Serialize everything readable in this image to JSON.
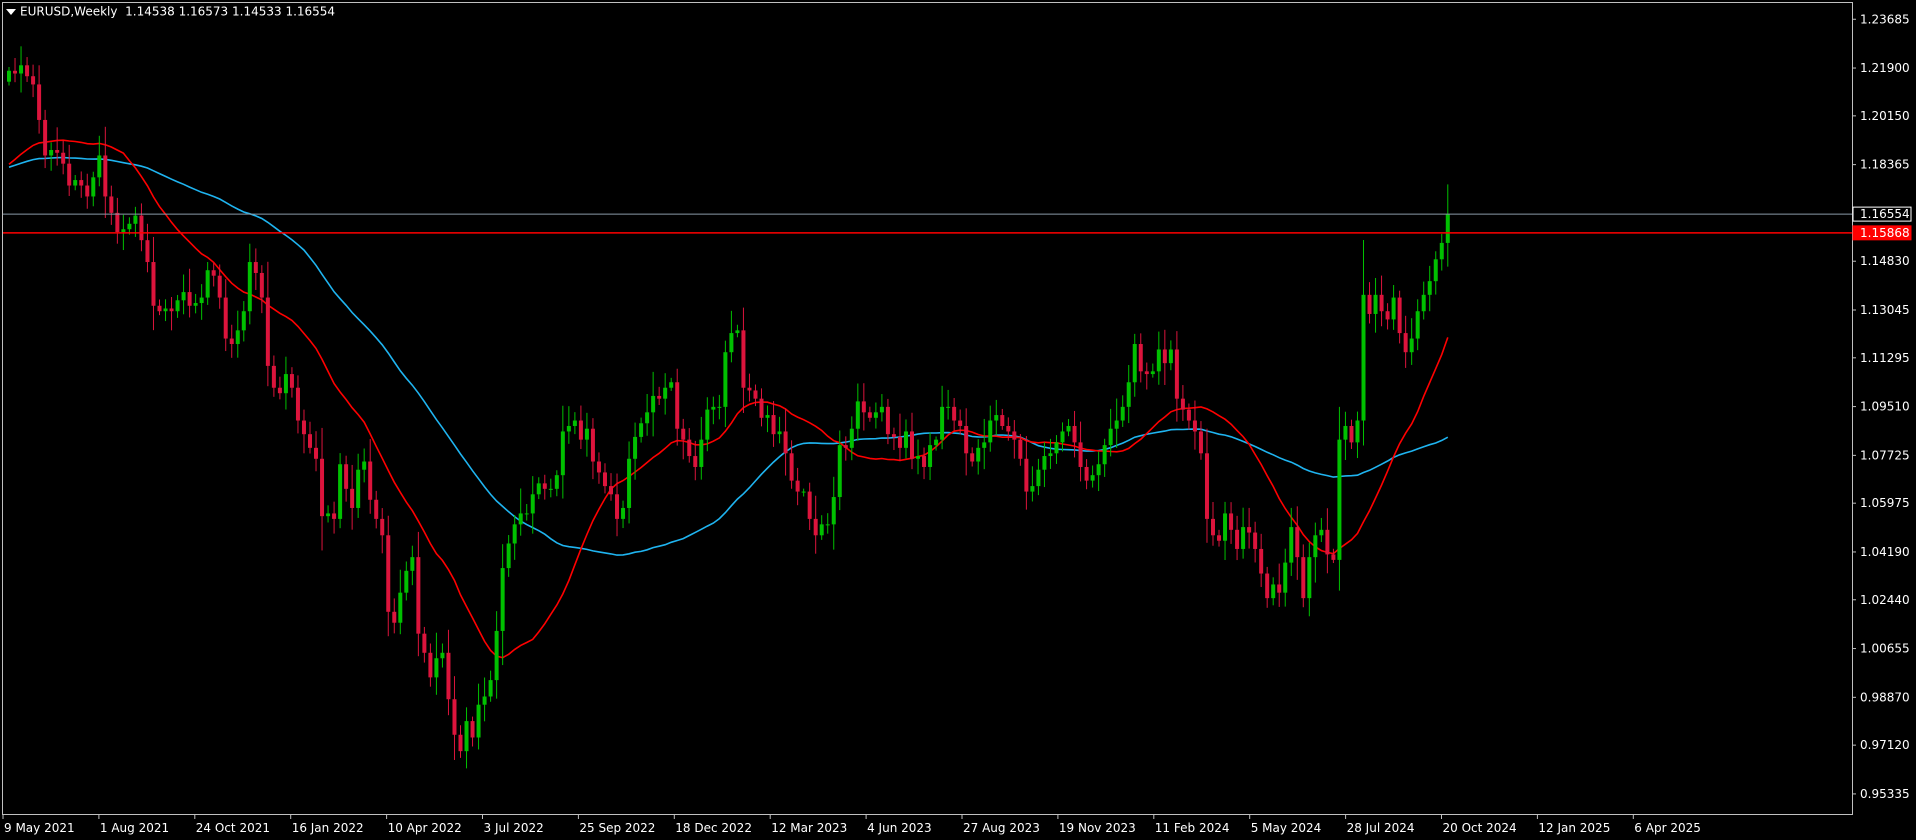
{
  "header": {
    "symbol": "EURUSD,Weekly",
    "ohlc": "1.14538 1.16573 1.14533 1.16554"
  },
  "colors": {
    "background": "#000000",
    "frame": "#c0c0c0",
    "bull": "#00c000",
    "bear": "#dc143c",
    "ma_fast": "#ff0000",
    "ma_slow": "#1fb4f0",
    "hline": "#ff0000",
    "bid_line": "#8a9aa8",
    "text": "#ffffff"
  },
  "chart_data": {
    "type": "candlestick",
    "symbol": "EURUSD",
    "timeframe": "Weekly",
    "ylim": [
      0.946,
      1.2428
    ],
    "y_ticks": [
      "1.23685",
      "1.21900",
      "1.20150",
      "1.18365",
      "1.16554",
      "1.14830",
      "1.13045",
      "1.11295",
      "1.09510",
      "1.07725",
      "1.05975",
      "1.04190",
      "1.02440",
      "1.00655",
      "0.98870",
      "0.97120",
      "0.95335"
    ],
    "x_ticks": [
      "9 May 2021",
      "1 Aug 2021",
      "24 Oct 2021",
      "16 Jan 2022",
      "10 Apr 2022",
      "3 Jul 2022",
      "25 Sep 2022",
      "18 Dec 2022",
      "12 Mar 2023",
      "4 Jun 2023",
      "27 Aug 2023",
      "19 Nov 2023",
      "11 Feb 2024",
      "5 May 2024",
      "28 Jul 2024",
      "20 Oct 2024",
      "12 Jan 2025",
      "6 Apr 2025"
    ],
    "price_labels": {
      "current": "1.16554",
      "hline": "1.15868"
    },
    "grid": false,
    "closes": [
      1.218,
      1.217,
      1.22,
      1.216,
      1.213,
      1.2,
      1.187,
      1.189,
      1.188,
      1.184,
      1.176,
      1.178,
      1.176,
      1.172,
      1.179,
      1.187,
      1.172,
      1.166,
      1.159,
      1.16,
      1.162,
      1.165,
      1.156,
      1.148,
      1.132,
      1.13,
      1.131,
      1.13,
      1.134,
      1.137,
      1.132,
      1.133,
      1.135,
      1.145,
      1.143,
      1.135,
      1.12,
      1.118,
      1.123,
      1.13,
      1.148,
      1.144,
      1.135,
      1.11,
      1.102,
      1.1,
      1.107,
      1.102,
      1.09,
      1.085,
      1.08,
      1.076,
      1.055,
      1.056,
      1.054,
      1.074,
      1.065,
      1.058,
      1.072,
      1.075,
      1.061,
      1.054,
      1.048,
      1.02,
      1.016,
      1.027,
      1.035,
      1.04,
      1.012,
      1.005,
      0.996,
      1.003,
      1.005,
      0.988,
      0.975,
      0.969,
      0.98,
      0.974,
      0.986,
      0.989,
      0.995,
      1.013,
      1.036,
      1.045,
      1.052,
      1.056,
      1.056,
      1.063,
      1.067,
      1.065,
      1.065,
      1.07,
      1.086,
      1.088,
      1.09,
      1.083,
      1.087,
      1.075,
      1.071,
      1.066,
      1.063,
      1.054,
      1.058,
      1.076,
      1.084,
      1.089,
      1.093,
      1.099,
      1.098,
      1.102,
      1.104,
      1.087,
      1.083,
      1.077,
      1.073,
      1.083,
      1.094,
      1.095,
      1.095,
      1.115,
      1.122,
      1.123,
      1.102,
      1.101,
      1.098,
      1.091,
      1.092,
      1.085,
      1.086,
      1.078,
      1.068,
      1.064,
      1.064,
      1.054,
      1.048,
      1.052,
      1.052,
      1.062,
      1.081,
      1.08,
      1.087,
      1.097,
      1.093,
      1.091,
      1.093,
      1.095,
      1.085,
      1.084,
      1.08,
      1.086,
      1.076,
      1.077,
      1.073,
      1.081,
      1.083,
      1.095,
      1.095,
      1.09,
      1.088,
      1.078,
      1.075,
      1.08,
      1.082,
      1.09,
      1.092,
      1.088,
      1.086,
      1.083,
      1.076,
      1.064,
      1.066,
      1.072,
      1.077,
      1.078,
      1.082,
      1.086,
      1.088,
      1.082,
      1.073,
      1.068,
      1.07,
      1.074,
      1.081,
      1.087,
      1.09,
      1.095,
      1.104,
      1.118,
      1.108,
      1.107,
      1.108,
      1.116,
      1.111,
      1.116,
      1.098,
      1.094,
      1.09,
      1.086,
      1.078,
      1.054,
      1.048,
      1.046,
      1.056,
      1.05,
      1.043,
      1.051,
      1.049,
      1.043,
      1.034,
      1.025,
      1.03,
      1.027,
      1.038,
      1.051,
      1.04,
      1.025,
      1.04,
      1.048,
      1.05,
      1.041,
      1.039,
      1.083,
      1.088,
      1.082,
      1.09,
      1.136,
      1.129,
      1.136,
      1.13,
      1.127,
      1.135,
      1.122,
      1.115,
      1.12,
      1.13,
      1.136,
      1.141,
      1.149,
      1.155,
      1.1655
    ]
  }
}
